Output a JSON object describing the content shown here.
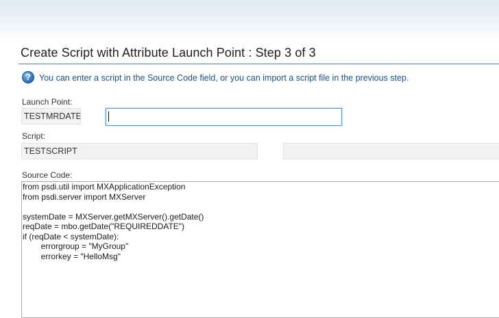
{
  "dialog": {
    "title": "Create Script with Attribute Launch Point : Step 3 of 3",
    "info_message": "You can enter a script in the Source Code field, or you can import a script file in the previous step."
  },
  "form": {
    "launch_point": {
      "label": "Launch Point:",
      "value": "TESTMRDATE",
      "description_value": ""
    },
    "script": {
      "label": "Script:",
      "value": "TESTSCRIPT",
      "description_value": ""
    },
    "source_code": {
      "label": "Source Code:",
      "value": "from psdi.util import MXApplicationException\nfrom psdi.server import MXServer\n\nsystemDate = MXServer.getMXServer().getDate()\nreqDate = mbo.getDate(\"REQUIREDDATE\")\nif (reqDate < systemDate):\n        errorgroup = \"MyGroup\"\n        errorkey = \"HelloMsg\""
    }
  },
  "icons": {
    "info": "info-help-icon"
  },
  "colors": {
    "info_text": "#1d4f86",
    "title_rule": "#4e7fb0",
    "focus_border": "#5a95c8"
  }
}
